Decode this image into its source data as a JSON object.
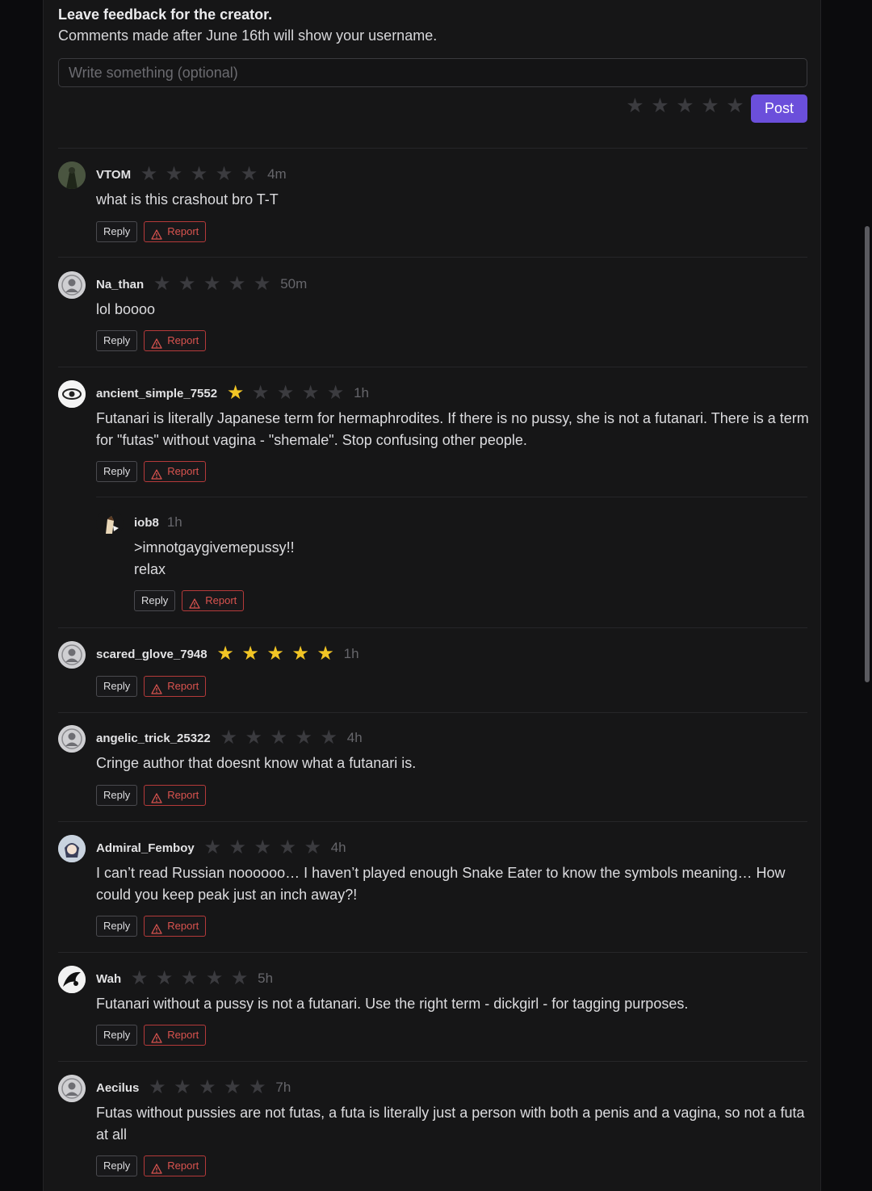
{
  "feedback": {
    "title": "Leave feedback for the creator.",
    "subtitle": "Comments made after June 16th will show your username.",
    "placeholder": "Write something (optional)",
    "post_label": "Post",
    "rating": 0
  },
  "labels": {
    "reply": "Reply",
    "report": "Report"
  },
  "colors": {
    "accent": "#6b4fdb",
    "star_on": "#f2c525",
    "star_off": "#3b3b3f",
    "report": "#d9534f"
  },
  "comments": [
    {
      "user": "VTOM",
      "rating": 0,
      "time": "4m",
      "text": "what is this crashout bro T-T"
    },
    {
      "user": "Na_than",
      "rating": 0,
      "time": "50m",
      "text": "lol boooo"
    },
    {
      "user": "ancient_simple_7552",
      "rating": 1,
      "time": "1h",
      "text": "Futanari is literally Japanese term for hermaphrodites. If there is no pussy, she is not a futanari. There is a term for \"futas\" without vagina - \"shemale\". Stop confusing other people.",
      "reply": {
        "user": "iob8",
        "time": "1h",
        "text": ">imnotgaygivemepussy!!\nrelax"
      }
    },
    {
      "user": "scared_glove_7948",
      "rating": 5,
      "time": "1h",
      "text": ""
    },
    {
      "user": "angelic_trick_25322",
      "rating": 0,
      "time": "4h",
      "text": "Cringe author that doesnt know what a futanari is."
    },
    {
      "user": "Admiral_Femboy",
      "rating": 0,
      "time": "4h",
      "text": "I can’t read Russian noooooo… I haven’t played enough Snake Eater to know the symbols meaning… How could you keep peak just an inch away?!"
    },
    {
      "user": "Wah",
      "rating": 0,
      "time": "5h",
      "text": "Futanari without a pussy is not a futanari. Use the right term - dickgirl - for tagging purposes."
    },
    {
      "user": "Aecilus",
      "rating": 0,
      "time": "7h",
      "text": "Futas without pussies are not futas, a futa is literally just a person with both a penis and a vagina, so not a futa at all"
    }
  ]
}
